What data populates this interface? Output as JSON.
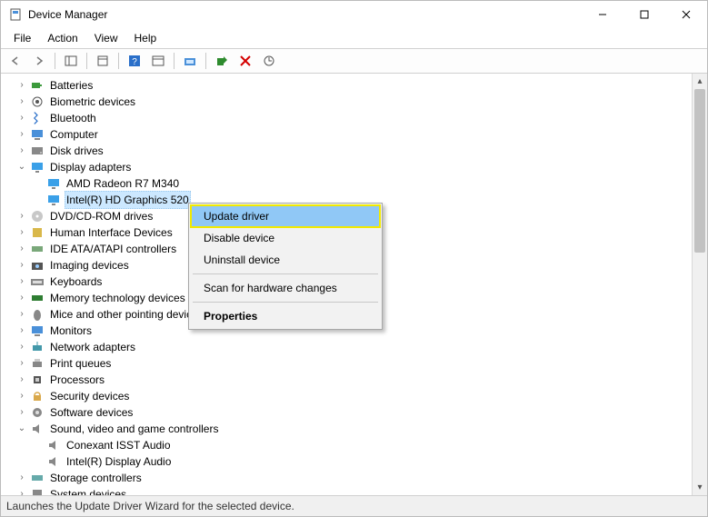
{
  "window": {
    "title": "Device Manager"
  },
  "menubar": {
    "file": "File",
    "action": "Action",
    "view": "View",
    "help": "Help"
  },
  "tree": {
    "items": [
      {
        "label": "Batteries",
        "expanded": false,
        "icon": "battery"
      },
      {
        "label": "Biometric devices",
        "expanded": false,
        "icon": "biometric"
      },
      {
        "label": "Bluetooth",
        "expanded": false,
        "icon": "bluetooth"
      },
      {
        "label": "Computer",
        "expanded": false,
        "icon": "computer"
      },
      {
        "label": "Disk drives",
        "expanded": false,
        "icon": "disk"
      },
      {
        "label": "Display adapters",
        "expanded": true,
        "icon": "display",
        "children": [
          {
            "label": "AMD Radeon R7 M340",
            "icon": "display",
            "selected": false
          },
          {
            "label": "Intel(R) HD Graphics 520",
            "icon": "display",
            "selected": true
          }
        ]
      },
      {
        "label": "DVD/CD-ROM drives",
        "expanded": false,
        "icon": "cdrom"
      },
      {
        "label": "Human Interface Devices",
        "expanded": false,
        "icon": "hid"
      },
      {
        "label": "IDE ATA/ATAPI controllers",
        "expanded": false,
        "icon": "ide"
      },
      {
        "label": "Imaging devices",
        "expanded": false,
        "icon": "imaging"
      },
      {
        "label": "Keyboards",
        "expanded": false,
        "icon": "keyboard"
      },
      {
        "label": "Memory technology devices",
        "expanded": false,
        "icon": "memory"
      },
      {
        "label": "Mice and other pointing devices",
        "expanded": false,
        "icon": "mouse"
      },
      {
        "label": "Monitors",
        "expanded": false,
        "icon": "monitor"
      },
      {
        "label": "Network adapters",
        "expanded": false,
        "icon": "network"
      },
      {
        "label": "Print queues",
        "expanded": false,
        "icon": "printer"
      },
      {
        "label": "Processors",
        "expanded": false,
        "icon": "cpu"
      },
      {
        "label": "Security devices",
        "expanded": false,
        "icon": "security"
      },
      {
        "label": "Software devices",
        "expanded": false,
        "icon": "software"
      },
      {
        "label": "Sound, video and game controllers",
        "expanded": true,
        "icon": "sound",
        "children": [
          {
            "label": "Conexant ISST Audio",
            "icon": "sound"
          },
          {
            "label": "Intel(R) Display Audio",
            "icon": "sound"
          }
        ]
      },
      {
        "label": "Storage controllers",
        "expanded": false,
        "icon": "storage"
      },
      {
        "label": "System devices",
        "expanded": false,
        "icon": "system"
      }
    ]
  },
  "contextMenu": {
    "items": [
      {
        "label": "Update driver",
        "highlight": true
      },
      {
        "label": "Disable device"
      },
      {
        "label": "Uninstall device"
      },
      {
        "sep": true
      },
      {
        "label": "Scan for hardware changes"
      },
      {
        "sep": true
      },
      {
        "label": "Properties",
        "bold": true
      }
    ]
  },
  "statusbar": {
    "text": "Launches the Update Driver Wizard for the selected device."
  },
  "icons": {
    "battery": "battery-icon",
    "biometric": "fingerprint-icon",
    "bluetooth": "bluetooth-icon",
    "computer": "computer-icon",
    "disk": "disk-icon",
    "display": "display-adapter-icon",
    "cdrom": "cdrom-icon",
    "hid": "hid-icon",
    "ide": "ide-icon",
    "imaging": "camera-icon",
    "keyboard": "keyboard-icon",
    "memory": "memory-icon",
    "mouse": "mouse-icon",
    "monitor": "monitor-icon",
    "network": "network-icon",
    "printer": "printer-icon",
    "cpu": "cpu-icon",
    "security": "lock-icon",
    "software": "gear-icon",
    "sound": "speaker-icon",
    "storage": "storage-icon",
    "system": "chip-icon"
  }
}
